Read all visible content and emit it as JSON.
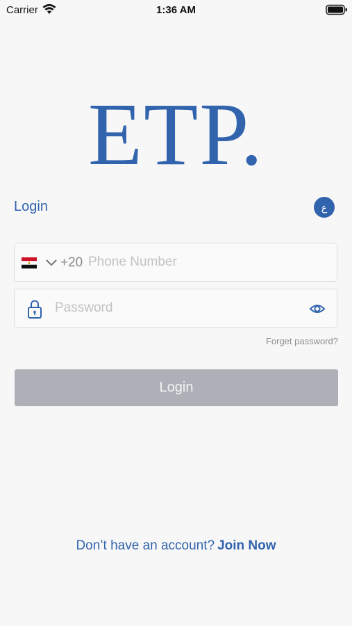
{
  "status_bar": {
    "carrier": "Carrier",
    "time": "1:36 AM"
  },
  "logo": {
    "text": "ETP",
    "dot": ".",
    "color": "#3264ad"
  },
  "login": {
    "title": "Login",
    "language_toggle": "ع"
  },
  "phone": {
    "country_flag": "egypt-flag",
    "dial_code": "+20",
    "placeholder": "Phone Number",
    "value": ""
  },
  "password": {
    "placeholder": "Password",
    "value": ""
  },
  "forget_password": "Forget password?",
  "login_button": "Login",
  "signup": {
    "prompt": "Don’t have an account?",
    "link": "Join Now"
  },
  "colors": {
    "accent": "#3264ad",
    "button_disabled": "#aeb0b8"
  }
}
